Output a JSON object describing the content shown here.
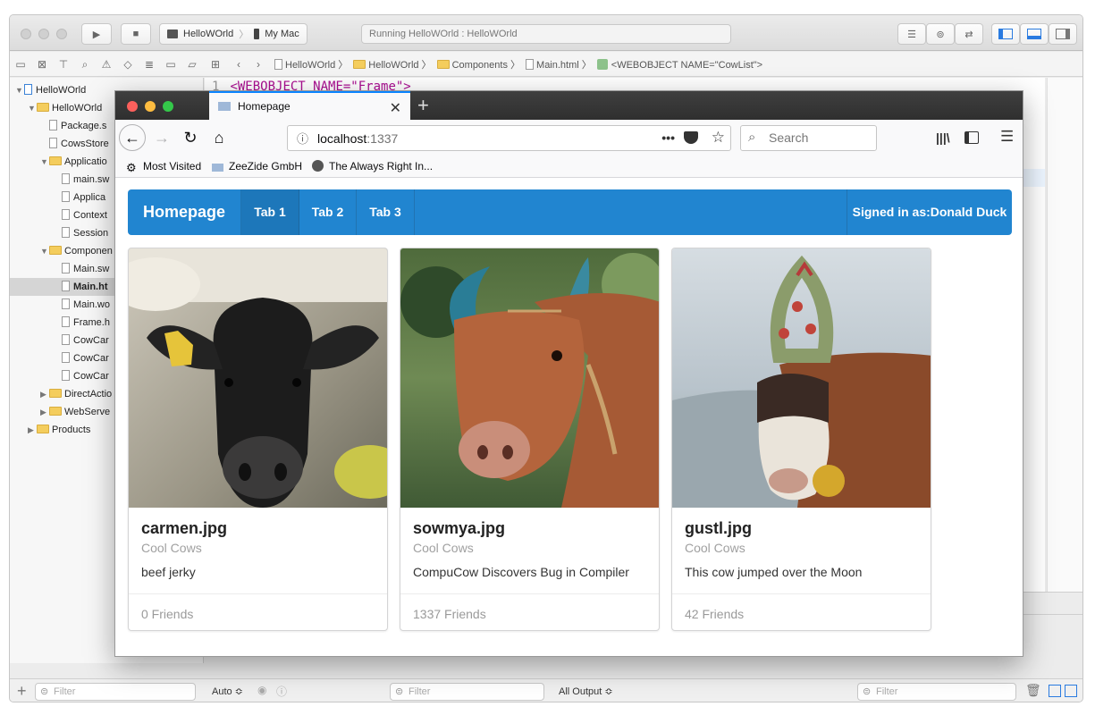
{
  "xcode": {
    "run_target": "HelloWOrld",
    "destination": "My Mac",
    "status": "Running HelloWOrld : HelloWOrld",
    "jump_bar": [
      "HelloWOrld",
      "HelloWOrld",
      "Components",
      "Main.html",
      "<WEBOBJECT NAME=\"CowList\">"
    ],
    "code_line_number": "1",
    "code_line": "<WEBOBJECT NAME=\"Frame\">",
    "navigator": [
      {
        "label": "HelloWOrld",
        "indent": 0,
        "disclosure": "▼",
        "kind": "project"
      },
      {
        "label": "HelloWOrld",
        "indent": 1,
        "disclosure": "▼",
        "kind": "folder"
      },
      {
        "label": "Package.s",
        "indent": 2,
        "disclosure": "",
        "kind": "file"
      },
      {
        "label": "CowsStore",
        "indent": 2,
        "disclosure": "",
        "kind": "file"
      },
      {
        "label": "Applicatio",
        "indent": 2,
        "disclosure": "▼",
        "kind": "folder"
      },
      {
        "label": "main.sw",
        "indent": 3,
        "disclosure": "",
        "kind": "file"
      },
      {
        "label": "Applica",
        "indent": 3,
        "disclosure": "",
        "kind": "file"
      },
      {
        "label": "Context",
        "indent": 3,
        "disclosure": "",
        "kind": "file"
      },
      {
        "label": "Session",
        "indent": 3,
        "disclosure": "",
        "kind": "file"
      },
      {
        "label": "Componen",
        "indent": 2,
        "disclosure": "▼",
        "kind": "folder"
      },
      {
        "label": "Main.sw",
        "indent": 3,
        "disclosure": "",
        "kind": "file"
      },
      {
        "label": "Main.ht",
        "indent": 3,
        "disclosure": "",
        "kind": "file",
        "selected": true
      },
      {
        "label": "Main.wo",
        "indent": 3,
        "disclosure": "",
        "kind": "file"
      },
      {
        "label": "Frame.h",
        "indent": 3,
        "disclosure": "",
        "kind": "file"
      },
      {
        "label": "CowCar",
        "indent": 3,
        "disclosure": "",
        "kind": "file"
      },
      {
        "label": "CowCar",
        "indent": 3,
        "disclosure": "",
        "kind": "file"
      },
      {
        "label": "CowCar",
        "indent": 3,
        "disclosure": "",
        "kind": "file"
      },
      {
        "label": "DirectActio",
        "indent": 2,
        "disclosure": "▶",
        "kind": "folder"
      },
      {
        "label": "WebServe",
        "indent": 2,
        "disclosure": "▶",
        "kind": "folder"
      },
      {
        "label": "Products",
        "indent": 1,
        "disclosure": "▶",
        "kind": "folder"
      }
    ],
    "filter_placeholder": "Filter",
    "auto_label": "Auto ≎",
    "output_label": "All Output ≎"
  },
  "browser": {
    "tab_title": "Homepage",
    "url_host": "localhost",
    "url_port": ":1337",
    "search_placeholder": "Search",
    "bookmarks": [
      "Most Visited",
      "ZeeZide GmbH",
      "The Always Right In..."
    ]
  },
  "site": {
    "brand": "Homepage",
    "tabs": [
      "Tab 1",
      "Tab 2",
      "Tab 3"
    ],
    "active_tab": "Tab 1",
    "signed_in": "Signed in as:Donald Duck",
    "accent": "#2185d0",
    "cards": [
      {
        "title": "carmen.jpg",
        "meta": "Cool Cows",
        "description": "beef jerky",
        "friends": "0 Friends"
      },
      {
        "title": "sowmya.jpg",
        "meta": "Cool Cows",
        "description": "CompuCow Discovers Bug in Compiler",
        "friends": "1337 Friends"
      },
      {
        "title": "gustl.jpg",
        "meta": "Cool Cows",
        "description": "This cow jumped over the Moon",
        "friends": "42 Friends"
      }
    ]
  }
}
